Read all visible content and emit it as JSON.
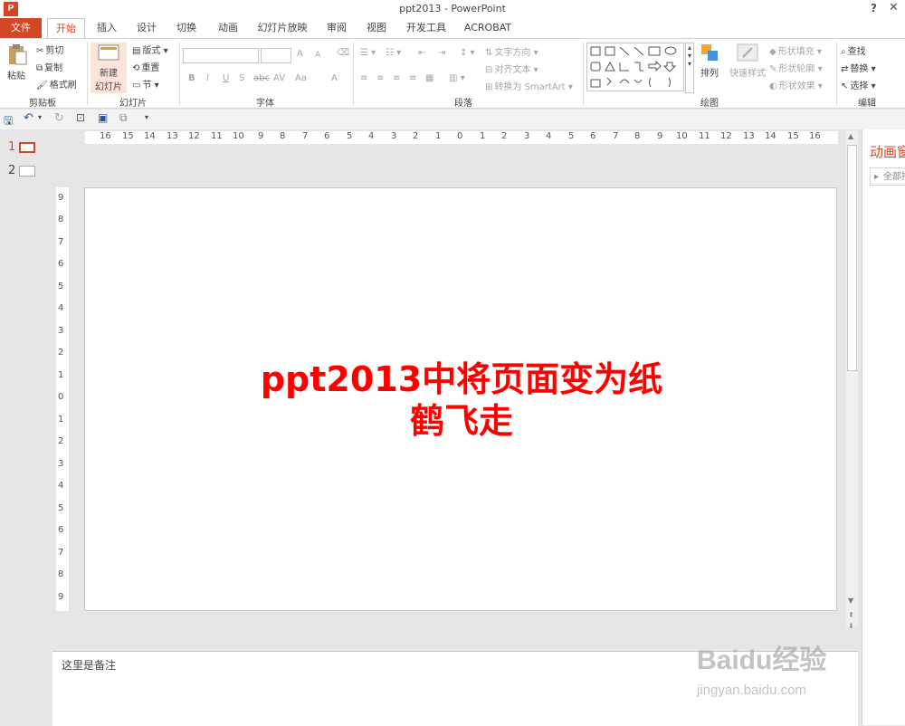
{
  "window": {
    "title": "ppt2013 - PowerPoint",
    "app_icon": "P",
    "help": "?",
    "close": "✕"
  },
  "tabs": [
    "文件",
    "开始",
    "插入",
    "设计",
    "切换",
    "动画",
    "幻灯片放映",
    "审阅",
    "视图",
    "开发工具",
    "ACROBAT"
  ],
  "ribbon": {
    "clipboard": {
      "paste": "粘贴",
      "cut": "剪切",
      "copy": "复制",
      "format_painter": "格式刷",
      "label": "剪贴板"
    },
    "slides": {
      "new_slide_1": "新建",
      "new_slide_2": "幻灯片",
      "layout": "版式",
      "reset": "重置",
      "section": "节",
      "label": "幻灯片"
    },
    "font": {
      "bold": "B",
      "italic": "I",
      "underline": "U",
      "shadow": "S",
      "strike": "abc",
      "spacing": "AV",
      "case": "Aa",
      "grow": "A",
      "shrink": "A",
      "color": "A",
      "label": "字体"
    },
    "paragraph": {
      "text_direction": "文字方向",
      "align_text": "对齐文本",
      "smartart": "转换为 SmartArt",
      "label": "段落"
    },
    "drawing": {
      "arrange": "排列",
      "quick_styles": "快速样式",
      "shape_fill": "形状填充",
      "shape_outline": "形状轮廓",
      "shape_effects": "形状效果",
      "label": "绘图"
    },
    "editing": {
      "find": "查找",
      "replace": "替换",
      "select": "选择",
      "label": "编辑"
    }
  },
  "thumbnails": [
    {
      "num": "1"
    },
    {
      "num": "2"
    }
  ],
  "hruler": [
    "16",
    "15",
    "14",
    "13",
    "12",
    "11",
    "10",
    "9",
    "8",
    "7",
    "6",
    "5",
    "4",
    "3",
    "2",
    "1",
    "0",
    "1",
    "2",
    "3",
    "4",
    "5",
    "6",
    "7",
    "8",
    "9",
    "10",
    "11",
    "12",
    "13",
    "14",
    "15",
    "16"
  ],
  "vruler": [
    "9",
    "8",
    "7",
    "6",
    "5",
    "4",
    "3",
    "2",
    "1",
    "0",
    "1",
    "2",
    "3",
    "4",
    "5",
    "6",
    "7",
    "8",
    "9"
  ],
  "slide": {
    "title_line1": "ppt2013中将页面变为纸",
    "title_line2": "鹤飞走",
    "title_color": "#ff0000"
  },
  "notes": {
    "text": "这里是备注"
  },
  "sidepane": {
    "title": "动画窗格",
    "button": "全部播放"
  },
  "watermark": {
    "text": "Baidu经验",
    "url": "jingyan.baidu.com"
  },
  "colors": {
    "accent": "#d24726"
  }
}
